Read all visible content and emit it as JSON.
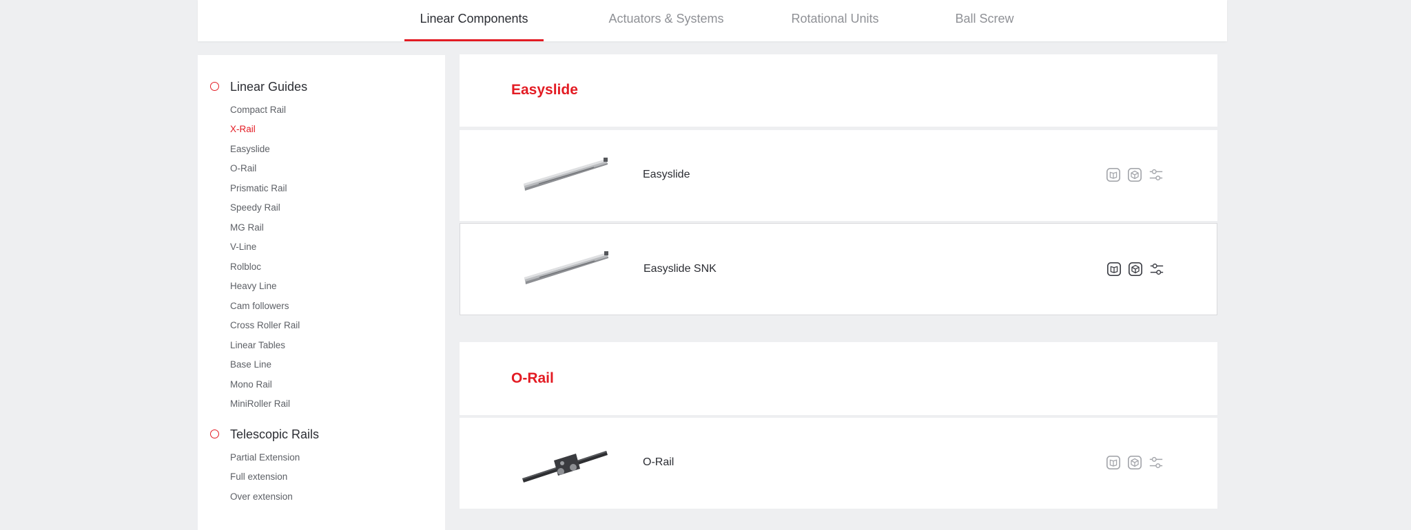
{
  "tabs": [
    {
      "label": "Linear Components",
      "active": true
    },
    {
      "label": "Actuators & Systems",
      "active": false
    },
    {
      "label": "Rotational Units",
      "active": false
    },
    {
      "label": "Ball Screw",
      "active": false
    }
  ],
  "sidebar": {
    "groups": [
      {
        "title": "Linear Guides",
        "items": [
          "Compact Rail",
          "X-Rail",
          "Easyslide",
          "O-Rail",
          "Prismatic Rail",
          "Speedy Rail",
          "MG Rail",
          "V-Line",
          "Rolbloc",
          "Heavy Line",
          "Cam followers",
          "Cross Roller Rail",
          "Linear Tables",
          "Base Line",
          "Mono Rail",
          "MiniRoller Rail"
        ],
        "active_item": "X-Rail"
      },
      {
        "title": "Telescopic Rails",
        "items": [
          "Partial Extension",
          "Full extension",
          "Over extension"
        ]
      }
    ]
  },
  "sections": [
    {
      "title": "Easyslide",
      "products": [
        {
          "name": "Easyslide",
          "image": "easyslide-rail"
        },
        {
          "name": "Easyslide SNK",
          "image": "easyslide-rail",
          "highlighted": true
        }
      ]
    },
    {
      "title": "O-Rail",
      "products": [
        {
          "name": "O-Rail",
          "image": "o-rail-carriage"
        }
      ]
    }
  ],
  "icons": {
    "catalog": "book-icon",
    "cad": "cube-icon",
    "configure": "sliders-icon"
  },
  "colors": {
    "accent": "#e31b23",
    "background": "#eeeff1",
    "card": "#ffffff",
    "text": "#2b2d33",
    "muted": "#8f9196"
  }
}
